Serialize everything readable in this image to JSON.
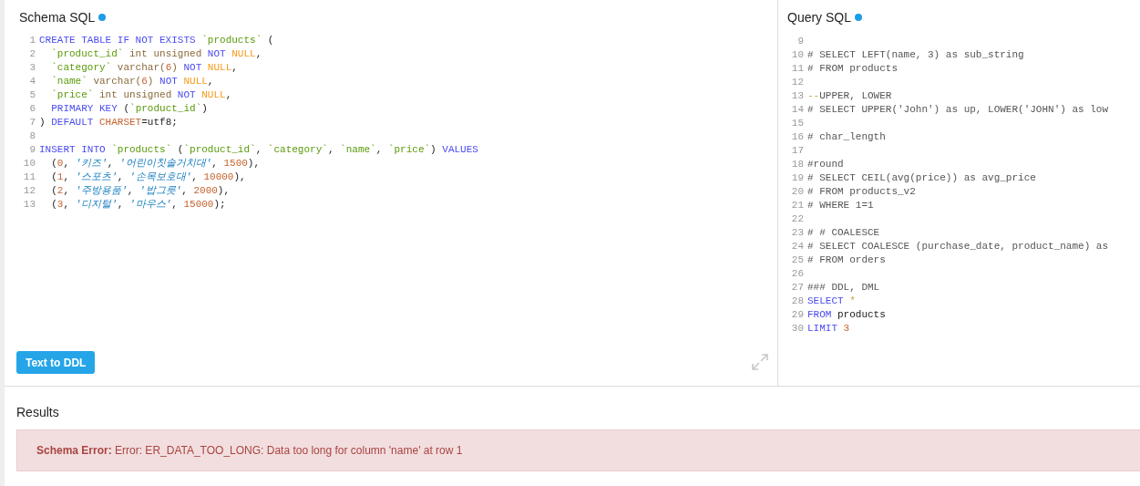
{
  "schema_pane": {
    "title": "Schema SQL",
    "unsaved": true,
    "button": "Text to DDL",
    "lines": [
      {
        "number": "1",
        "tokens": [
          {
            "kind": "keyword",
            "text": "CREATE TABLE IF NOT EXISTS "
          },
          {
            "kind": "ident",
            "text": "`products`"
          },
          {
            "kind": "plain",
            "text": " ("
          }
        ]
      },
      {
        "number": "2",
        "tokens": [
          {
            "kind": "ident",
            "text": "  `product_id`"
          },
          {
            "kind": "type",
            "text": " int unsigned "
          },
          {
            "kind": "keyword",
            "text": "NOT "
          },
          {
            "kind": "atom",
            "text": "NULL"
          },
          {
            "kind": "plain",
            "text": ","
          }
        ]
      },
      {
        "number": "3",
        "tokens": [
          {
            "kind": "ident",
            "text": "  `category`"
          },
          {
            "kind": "type",
            "text": " varchar("
          },
          {
            "kind": "number",
            "text": "6"
          },
          {
            "kind": "type",
            "text": ") "
          },
          {
            "kind": "keyword",
            "text": "NOT "
          },
          {
            "kind": "atom",
            "text": "NULL"
          },
          {
            "kind": "plain",
            "text": ","
          }
        ]
      },
      {
        "number": "4",
        "tokens": [
          {
            "kind": "ident",
            "text": "  `name`"
          },
          {
            "kind": "type",
            "text": " varchar("
          },
          {
            "kind": "number",
            "text": "6"
          },
          {
            "kind": "type",
            "text": ") "
          },
          {
            "kind": "keyword",
            "text": "NOT "
          },
          {
            "kind": "atom",
            "text": "NULL"
          },
          {
            "kind": "plain",
            "text": ","
          }
        ]
      },
      {
        "number": "5",
        "tokens": [
          {
            "kind": "ident",
            "text": "  `price`"
          },
          {
            "kind": "type",
            "text": " int unsigned "
          },
          {
            "kind": "keyword",
            "text": "NOT "
          },
          {
            "kind": "atom",
            "text": "NULL"
          },
          {
            "kind": "plain",
            "text": ","
          }
        ]
      },
      {
        "number": "6",
        "tokens": [
          {
            "kind": "keyword",
            "text": "  PRIMARY KEY "
          },
          {
            "kind": "plain",
            "text": "("
          },
          {
            "kind": "ident",
            "text": "`product_id`"
          },
          {
            "kind": "plain",
            "text": ")"
          }
        ]
      },
      {
        "number": "7",
        "tokens": [
          {
            "kind": "plain",
            "text": ") "
          },
          {
            "kind": "keyword",
            "text": "DEFAULT "
          },
          {
            "kind": "builtin",
            "text": "CHARSET"
          },
          {
            "kind": "plain",
            "text": "=utf8;"
          }
        ]
      },
      {
        "number": "8"
      },
      {
        "number": "9",
        "tokens": [
          {
            "kind": "keyword",
            "text": "INSERT INTO "
          },
          {
            "kind": "ident",
            "text": "`products`"
          },
          {
            "kind": "plain",
            "text": " ("
          },
          {
            "kind": "ident",
            "text": "`product_id`"
          },
          {
            "kind": "plain",
            "text": ", "
          },
          {
            "kind": "ident",
            "text": "`category`"
          },
          {
            "kind": "plain",
            "text": ", "
          },
          {
            "kind": "ident",
            "text": "`name`"
          },
          {
            "kind": "plain",
            "text": ", "
          },
          {
            "kind": "ident",
            "text": "`price`"
          },
          {
            "kind": "plain",
            "text": ") "
          },
          {
            "kind": "keyword",
            "text": "VALUES"
          }
        ]
      },
      {
        "number": "10",
        "tokens": [
          {
            "kind": "plain",
            "text": "  ("
          },
          {
            "kind": "number",
            "text": "0"
          },
          {
            "kind": "plain",
            "text": ", "
          },
          {
            "kind": "string",
            "text": "'키즈'"
          },
          {
            "kind": "plain",
            "text": ", "
          },
          {
            "kind": "string",
            "text": "'어린이칫솔거치대'"
          },
          {
            "kind": "plain",
            "text": ", "
          },
          {
            "kind": "number",
            "text": "1500"
          },
          {
            "kind": "plain",
            "text": "),"
          }
        ]
      },
      {
        "number": "11",
        "tokens": [
          {
            "kind": "plain",
            "text": "  ("
          },
          {
            "kind": "number",
            "text": "1"
          },
          {
            "kind": "plain",
            "text": ", "
          },
          {
            "kind": "string",
            "text": "'스포츠'"
          },
          {
            "kind": "plain",
            "text": ", "
          },
          {
            "kind": "string",
            "text": "'손목보호대'"
          },
          {
            "kind": "plain",
            "text": ", "
          },
          {
            "kind": "number",
            "text": "10000"
          },
          {
            "kind": "plain",
            "text": "),"
          }
        ]
      },
      {
        "number": "12",
        "tokens": [
          {
            "kind": "plain",
            "text": "  ("
          },
          {
            "kind": "number",
            "text": "2"
          },
          {
            "kind": "plain",
            "text": ", "
          },
          {
            "kind": "string",
            "text": "'주방용품'"
          },
          {
            "kind": "plain",
            "text": ", "
          },
          {
            "kind": "string",
            "text": "'밥그릇'"
          },
          {
            "kind": "plain",
            "text": ", "
          },
          {
            "kind": "number",
            "text": "2000"
          },
          {
            "kind": "plain",
            "text": "),"
          }
        ]
      },
      {
        "number": "13",
        "tokens": [
          {
            "kind": "plain",
            "text": "  ("
          },
          {
            "kind": "number",
            "text": "3"
          },
          {
            "kind": "plain",
            "text": ", "
          },
          {
            "kind": "string",
            "text": "'디지털'"
          },
          {
            "kind": "plain",
            "text": ", "
          },
          {
            "kind": "string",
            "text": "'마우스'"
          },
          {
            "kind": "plain",
            "text": ", "
          },
          {
            "kind": "number",
            "text": "15000"
          },
          {
            "kind": "plain",
            "text": ");"
          }
        ]
      }
    ]
  },
  "query_pane": {
    "title": "Query SQL",
    "unsaved": true,
    "lines": [
      {
        "number": "9"
      },
      {
        "number": "10",
        "tokens": [
          {
            "kind": "comment",
            "text": "# SELECT LEFT(name, 3) as sub_string"
          }
        ]
      },
      {
        "number": "11",
        "tokens": [
          {
            "kind": "comment",
            "text": "# FROM products"
          }
        ]
      },
      {
        "number": "12"
      },
      {
        "number": "13",
        "tokens": [
          {
            "kind": "operator",
            "text": "--"
          },
          {
            "kind": "comment",
            "text": "UPPER, LOWER"
          }
        ]
      },
      {
        "number": "14",
        "tokens": [
          {
            "kind": "comment",
            "text": "# SELECT UPPER('John') as up, LOWER('JOHN') as low"
          }
        ]
      },
      {
        "number": "15"
      },
      {
        "number": "16",
        "tokens": [
          {
            "kind": "comment",
            "text": "# char_length"
          }
        ]
      },
      {
        "number": "17"
      },
      {
        "number": "18",
        "tokens": [
          {
            "kind": "comment",
            "text": "#round"
          }
        ]
      },
      {
        "number": "19",
        "tokens": [
          {
            "kind": "comment",
            "text": "# SELECT CEIL(avg(price)) as avg_price"
          }
        ]
      },
      {
        "number": "20",
        "tokens": [
          {
            "kind": "comment",
            "text": "# FROM products_v2"
          }
        ]
      },
      {
        "number": "21",
        "tokens": [
          {
            "kind": "comment",
            "text": "# WHERE 1=1"
          }
        ]
      },
      {
        "number": "22"
      },
      {
        "number": "23",
        "tokens": [
          {
            "kind": "comment",
            "text": "# # COALESCE"
          }
        ]
      },
      {
        "number": "24",
        "tokens": [
          {
            "kind": "comment",
            "text": "# SELECT COALESCE (purchase_date, product_name) as"
          }
        ]
      },
      {
        "number": "25",
        "tokens": [
          {
            "kind": "comment",
            "text": "# FROM orders"
          }
        ]
      },
      {
        "number": "26"
      },
      {
        "number": "27",
        "tokens": [
          {
            "kind": "comment",
            "text": "### DDL, DML"
          }
        ]
      },
      {
        "number": "28",
        "tokens": [
          {
            "kind": "keyword",
            "text": "SELECT "
          },
          {
            "kind": "operator",
            "text": "*"
          }
        ]
      },
      {
        "number": "29",
        "tokens": [
          {
            "kind": "keyword",
            "text": "FROM "
          },
          {
            "kind": "plain",
            "text": "products"
          }
        ]
      },
      {
        "number": "30",
        "tokens": [
          {
            "kind": "keyword",
            "text": "LIMIT "
          },
          {
            "kind": "number",
            "text": "3"
          }
        ]
      }
    ]
  },
  "results": {
    "title": "Results",
    "error": {
      "label": "Schema Error:",
      "message": "Error: ER_DATA_TOO_LONG: Data too long for column 'name' at row 1"
    }
  }
}
